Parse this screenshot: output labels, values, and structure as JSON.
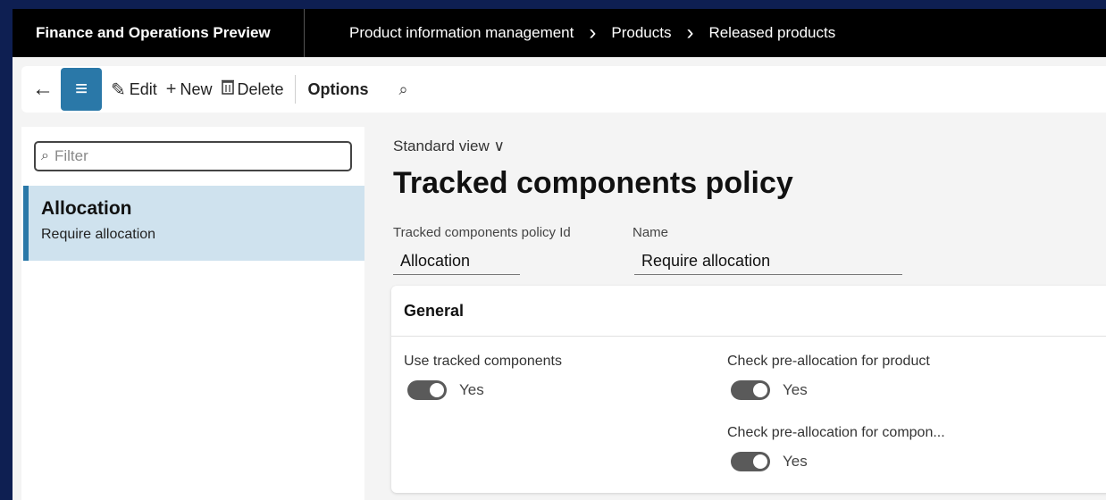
{
  "app": {
    "title": "Finance and Operations Preview"
  },
  "breadcrumbs": [
    "Product information management",
    "Products",
    "Released products"
  ],
  "actions": {
    "edit": "Edit",
    "new": "New",
    "delete": "Delete",
    "options": "Options"
  },
  "filter": {
    "placeholder": "Filter",
    "value": ""
  },
  "list": [
    {
      "title": "Allocation",
      "subtitle": "Require allocation"
    }
  ],
  "view": {
    "label": "Standard view"
  },
  "page": {
    "title": "Tracked components policy"
  },
  "fields": {
    "policy_id": {
      "label": "Tracked components policy Id",
      "value": "Allocation"
    },
    "name": {
      "label": "Name",
      "value": "Require allocation"
    }
  },
  "general": {
    "title": "General",
    "toggles": [
      {
        "label": "Use tracked components",
        "value": "Yes"
      },
      {
        "label": "Check pre-allocation for product",
        "value": "Yes"
      },
      {
        "label": "Check pre-allocation for compon...",
        "value": "Yes"
      }
    ]
  },
  "colors": {
    "accent": "#2a78a8",
    "selection": "#cfe2ee",
    "outer": "#0e1f52"
  }
}
